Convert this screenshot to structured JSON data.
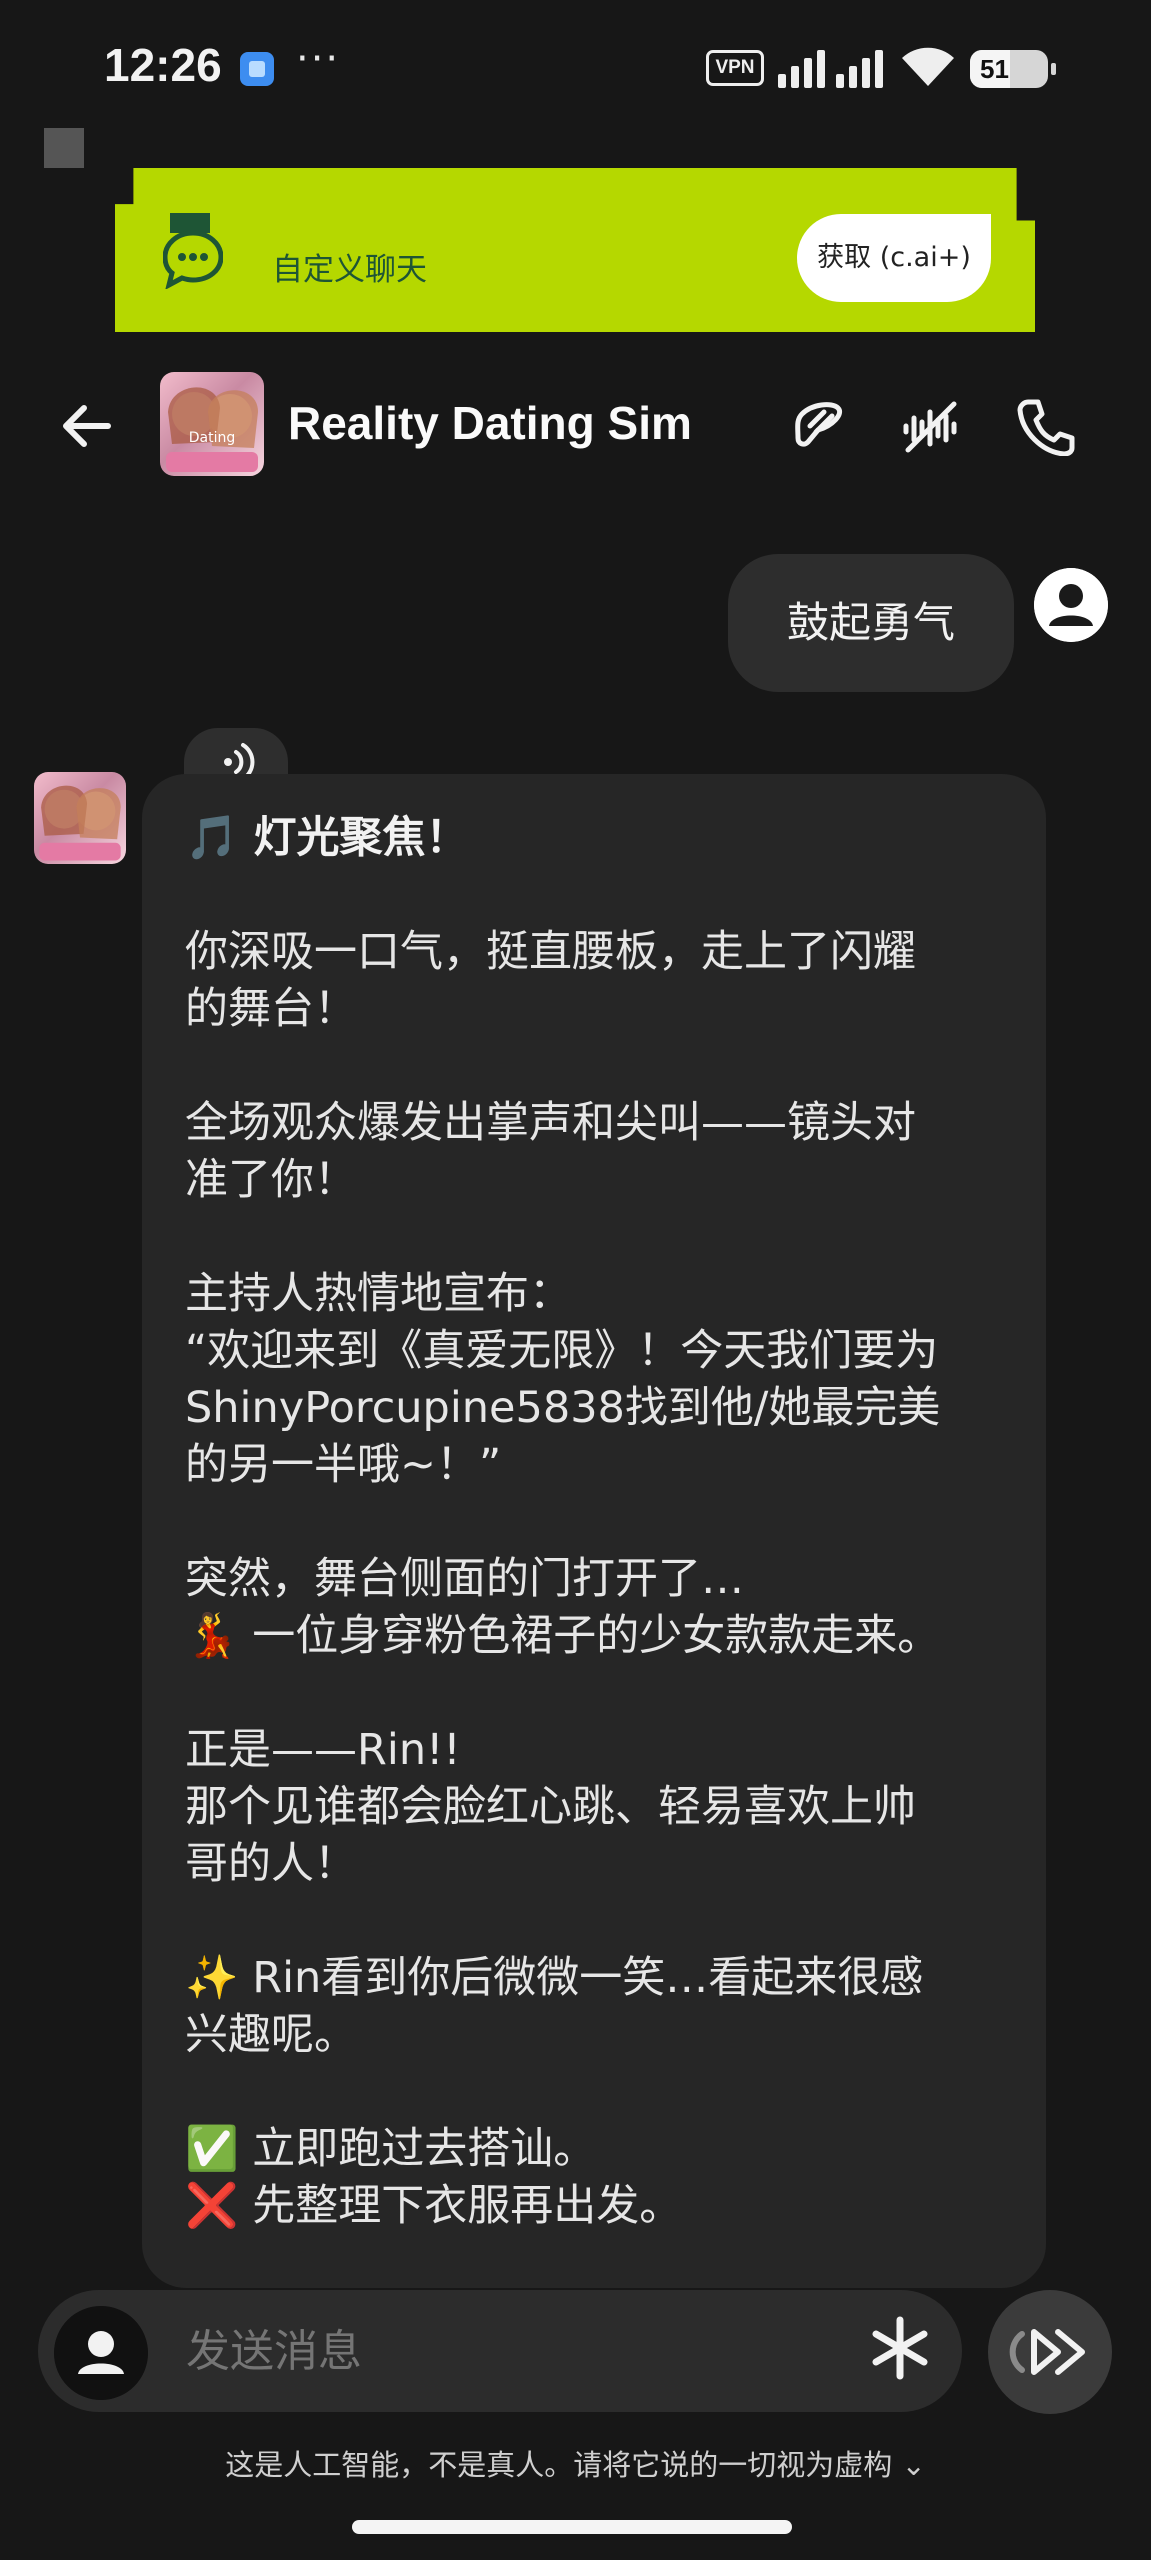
{
  "status_bar": {
    "time": "12:26",
    "vpn": "VPN",
    "battery": "51",
    "battery_level": 0.51
  },
  "banner": {
    "text": "自定义聊天",
    "button": "获取 (c.ai+)",
    "color": "#b5d800"
  },
  "header": {
    "title": "Reality Dating Sim",
    "avatar_text": "Dating"
  },
  "user_message": {
    "text": "鼓起勇气"
  },
  "bot_message": {
    "lines": [
      "🎵 灯光聚焦！",
      "",
      "你深吸一口气，挺直腰板，走上了闪耀",
      "的舞台！",
      "",
      "全场观众爆发出掌声和尖叫——镜头对",
      "准了你！",
      "",
      "主持人热情地宣布：",
      "“欢迎来到《真爱无限》！今天我们要为",
      "ShinyPorcupine5838找到他/她最完美",
      "的另一半哦~！”",
      "",
      "突然，舞台侧面的门打开了…",
      "💃 一位身穿粉色裙子的少女款款走来。",
      "",
      "正是——Rin!!",
      "那个见谁都会脸红心跳、轻易喜欢上帅",
      "哥的人！",
      "",
      "✨ Rin看到你后微微一笑…看起来很感",
      "兴趣呢。",
      "",
      "✅ 立即跑过去搭讪。",
      "❌ 先整理下衣服再出发。"
    ]
  },
  "composer": {
    "placeholder": "发送消息"
  },
  "footer": {
    "disclaimer": "这是人工智能，不是真人。请将它说的一切视为虚构 ⌄"
  }
}
